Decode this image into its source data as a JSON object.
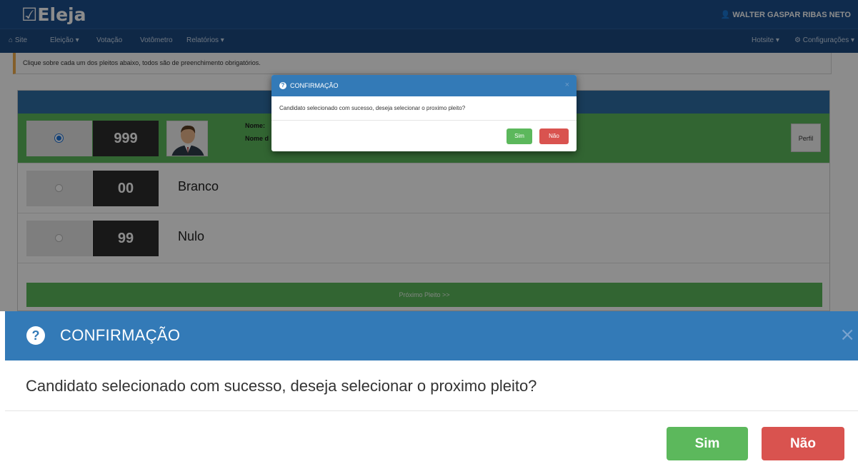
{
  "app": {
    "brand": "Eleja",
    "user_name": "WALTER GASPAR RIBAS NETO"
  },
  "nav": {
    "items": [
      "Site",
      "Eleição ▾",
      "Votação",
      "Votômetro",
      "Relatórios ▾"
    ],
    "right_items": [
      "Hotsite ▾",
      "Configurações ▾"
    ]
  },
  "alert": {
    "text": "Clique sobre cada um dos pleitos abaixo, todos são de preenchimento obrigatórios."
  },
  "candidates": {
    "rows": [
      {
        "number": "999",
        "label_name": "Nome:",
        "label_name2": "Nome d",
        "selected": true
      },
      {
        "number": "00",
        "name": "Branco",
        "selected": false
      },
      {
        "number": "99",
        "name": "Nulo",
        "selected": false
      }
    ],
    "perfil_label": "Perfil",
    "next_label": "Próximo Pleito >>"
  },
  "mini_modal": {
    "title": "CONFIRMAÇÃO",
    "message": "Candidato selecionado com sucesso, deseja selecionar o proximo pleito?",
    "yes": "Sim",
    "no": "Não"
  },
  "modal": {
    "title": "CONFIRMAÇÃO",
    "message": "Candidato selecionado com sucesso, deseja selecionar o proximo pleito?",
    "close_symbol": "×",
    "yes": "Sim",
    "no": "Não"
  },
  "colors": {
    "header_blue": "#337ab7",
    "success_green": "#5cb85c",
    "danger_red": "#d9534f",
    "brand_bar": "#1d4f8c"
  },
  "icons": {
    "question": "question-circle-icon",
    "close": "close-icon",
    "home": "home-icon",
    "user": "user-icon",
    "gear": "gear-icon",
    "logo_check": "checkbox-icon"
  }
}
